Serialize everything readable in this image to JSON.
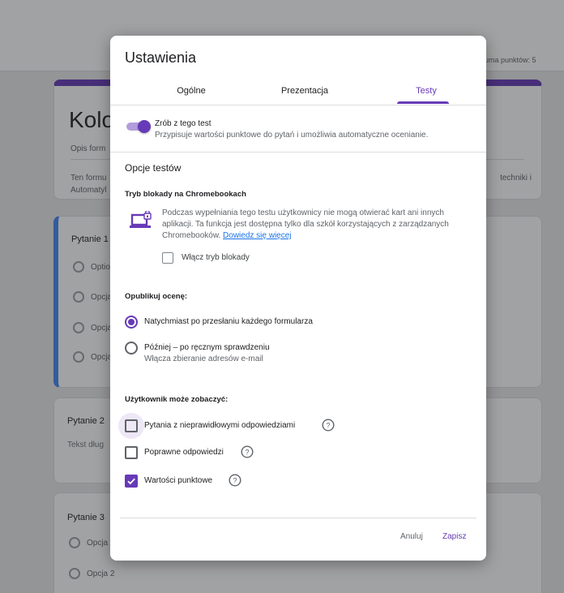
{
  "background": {
    "total_points": "uma punktów: 5",
    "form_title": "Kolo",
    "form_description_placeholder": "Opis form",
    "form_desc_line1": "Ten formu",
    "form_desc_line2": "Automatyl",
    "form_desc_right": "techniki i",
    "q1": {
      "title": "Pytanie 1",
      "options": [
        "Optio",
        "Opcja",
        "Opcja",
        "Opcja"
      ]
    },
    "q2": {
      "title": "Pytanie 2",
      "hint": "Tekst dług"
    },
    "q3": {
      "title": "Pytanie 3",
      "options": [
        "Opcja",
        "Opcja 2"
      ]
    }
  },
  "dialog": {
    "title": "Ustawienia",
    "tabs": [
      "Ogólne",
      "Prezentacja",
      "Testy"
    ],
    "active_tab": "Testy",
    "accent_color": "#673ab7",
    "quiz_toggle": {
      "label": "Zrób z tego test",
      "description": "Przypisuje wartości punktowe do pytań i umożliwia automatyczne ocenianie.",
      "enabled": true
    },
    "quiz_options_heading": "Opcje testów",
    "lock_mode": {
      "heading": "Tryb blokady na Chromebookach",
      "description": "Podczas wypełniania tego testu użytkownicy nie mogą otwierać kart ani innych aplikacji. Ta funkcja jest dostępna tylko dla szkół korzystających z zarządzanych Chromebooków.",
      "learn_more": "Dowiedz się więcej",
      "checkbox_label": "Włącz tryb blokady",
      "checked": false
    },
    "release_grade": {
      "heading": "Opublikuj ocenę:",
      "option1": "Natychmiast po przesłaniu każdego formularza",
      "option2": "Później – po ręcznym sprawdzeniu",
      "option2_sub": "Włącza zbieranie adresów e-mail",
      "selected": "option1"
    },
    "respondent_can_see": {
      "heading": "Użytkownik może zobaczyć:",
      "items": [
        {
          "label": "Pytania z nieprawidłowymi odpowiedziami",
          "checked": false
        },
        {
          "label": "Poprawne odpowiedzi",
          "checked": false
        },
        {
          "label": "Wartości punktowe",
          "checked": true
        }
      ]
    },
    "buttons": {
      "cancel": "Anuluj",
      "save": "Zapisz"
    }
  }
}
